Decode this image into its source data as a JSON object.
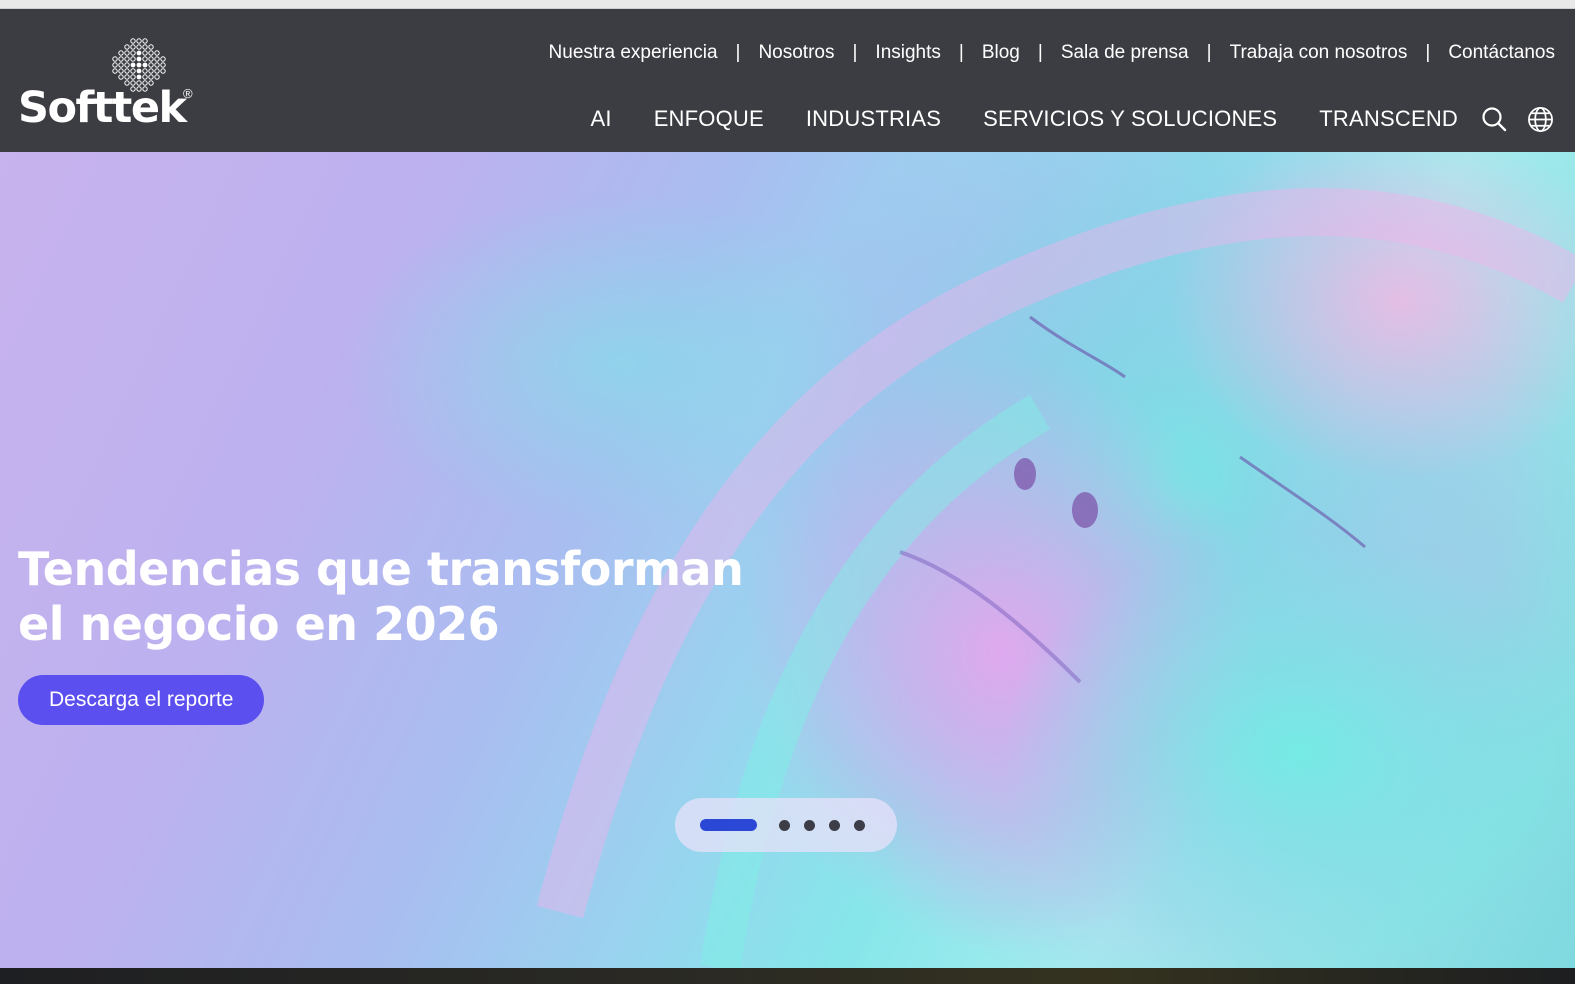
{
  "brand": {
    "name": "Softtek",
    "registered_mark": "®"
  },
  "utility_nav": [
    {
      "label": "Nuestra experiencia"
    },
    {
      "label": "Nosotros"
    },
    {
      "label": "Insights"
    },
    {
      "label": "Blog"
    },
    {
      "label": "Sala de prensa"
    },
    {
      "label": "Trabaja con nosotros"
    },
    {
      "label": "Contáctanos"
    }
  ],
  "utility_separator": "|",
  "main_nav": [
    {
      "label": "AI"
    },
    {
      "label": "ENFOQUE"
    },
    {
      "label": "INDUSTRIAS"
    },
    {
      "label": "SERVICIOS Y SOLUCIONES"
    },
    {
      "label": "TRANSCEND"
    }
  ],
  "header_icons": [
    "search-icon",
    "globe-icon"
  ],
  "hero": {
    "title_line1": "Tendencias que transforman",
    "title_line2": "el negocio en 2026",
    "cta_label": "Descarga el reporte"
  },
  "carousel": {
    "total_slides": 5,
    "active_slide": 1
  },
  "colors": {
    "header_bg": "#3c3d42",
    "cta_bg": "#5b4ff0",
    "carousel_active": "#2a47d6"
  }
}
